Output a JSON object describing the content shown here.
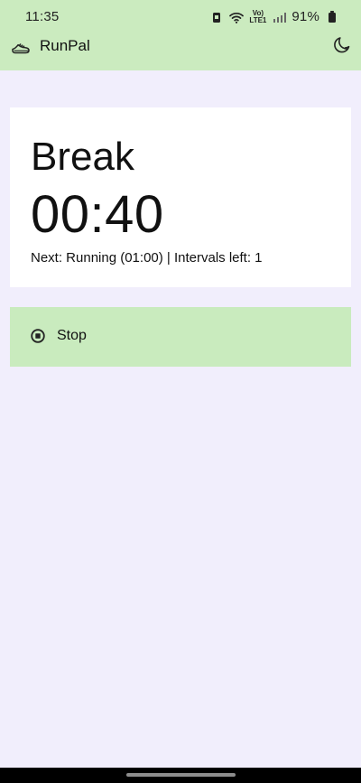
{
  "status_bar": {
    "time": "11:35",
    "network_top": "Vo)",
    "network_bottom": "LTE1",
    "battery_percent": "91%",
    "icons": [
      "sim-lock-icon",
      "wifi-icon",
      "signal-icon",
      "battery-icon"
    ]
  },
  "app_bar": {
    "title": "RunPal",
    "left_icon": "running-shoe-icon",
    "right_icon": "moon-icon"
  },
  "timer_card": {
    "phase": "Break",
    "time_remaining": "00:40",
    "next_info": "Next: Running (01:00) | Intervals left: 1"
  },
  "stop_button": {
    "label": "Stop",
    "icon": "stop-icon"
  },
  "colors": {
    "background": "#f1eefc",
    "accent_green": "#cbebbf",
    "card_white": "#ffffff",
    "nav_bar": "#000000"
  }
}
